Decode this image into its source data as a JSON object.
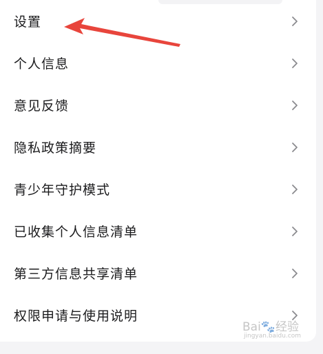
{
  "menu": {
    "items": [
      {
        "label": "设置"
      },
      {
        "label": "个人信息"
      },
      {
        "label": "意见反馈"
      },
      {
        "label": "隐私政策摘要"
      },
      {
        "label": "青少年守护模式"
      },
      {
        "label": "已收集个人信息清单"
      },
      {
        "label": "第三方信息共享清单"
      },
      {
        "label": "权限申请与使用说明"
      }
    ],
    "chevron_icon": "chevron-right-icon"
  },
  "annotation": {
    "arrow_color": "#e8453c",
    "arrow_icon": "red-arrow-icon"
  },
  "watermark": {
    "logo": "Bai🐾经验",
    "url": "jingyan.baidu.com"
  }
}
